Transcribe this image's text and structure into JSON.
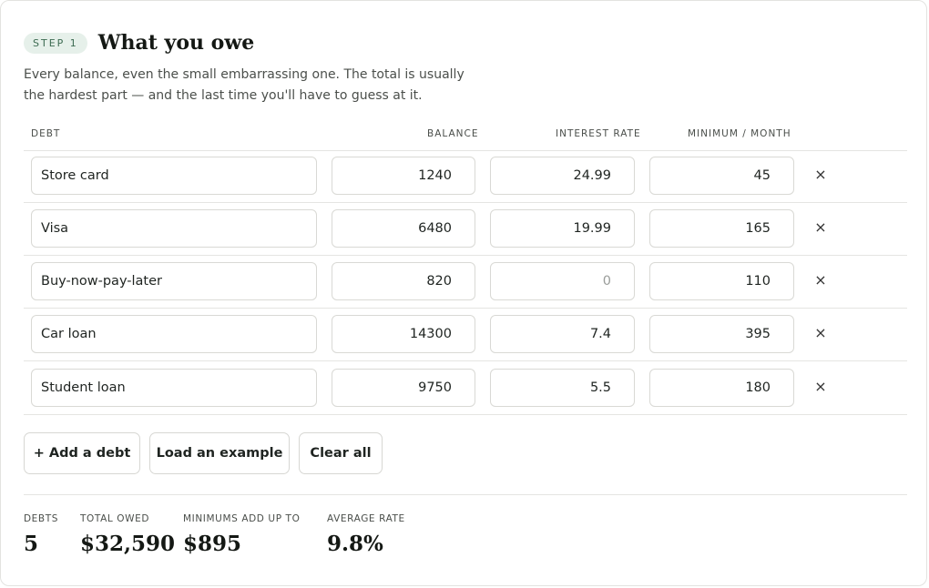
{
  "step": {
    "pill": "STEP 1",
    "title": "What you owe",
    "intro": "Every balance, even the small embarrassing one. The total is usually the hardest part — and the last time you'll have to guess at it."
  },
  "table": {
    "headers": {
      "debt": "DEBT",
      "balance": "BALANCE",
      "rate": "INTEREST RATE",
      "minimum": "MINIMUM / MONTH"
    },
    "rows": [
      {
        "name": "Store card",
        "balance": "1240",
        "rate": "24.99",
        "minimum": "45"
      },
      {
        "name": "Visa",
        "balance": "6480",
        "rate": "19.99",
        "minimum": "165"
      },
      {
        "name": "Buy-now-pay-later",
        "balance": "820",
        "rate": "0",
        "minimum": "110"
      },
      {
        "name": "Car loan",
        "balance": "14300",
        "rate": "7.4",
        "minimum": "395"
      },
      {
        "name": "Student loan",
        "balance": "9750",
        "rate": "5.5",
        "minimum": "180"
      }
    ],
    "remove_glyph": "×"
  },
  "actions": {
    "add": "+ Add a debt",
    "example": "Load an example",
    "clear": "Clear all"
  },
  "summary": {
    "debts_label": "DEBTS",
    "debts_value": "5",
    "total_label": "TOTAL OWED",
    "total_value": "$32,590",
    "minimums_label": "MINIMUMS ADD UP TO",
    "minimums_value": "$895",
    "avg_label": "AVERAGE RATE",
    "avg_value": "9.8%"
  },
  "colors": {
    "pill_bg": "#e6f0ea",
    "pill_text": "#3d6b52",
    "border": "#d9d9d5"
  }
}
